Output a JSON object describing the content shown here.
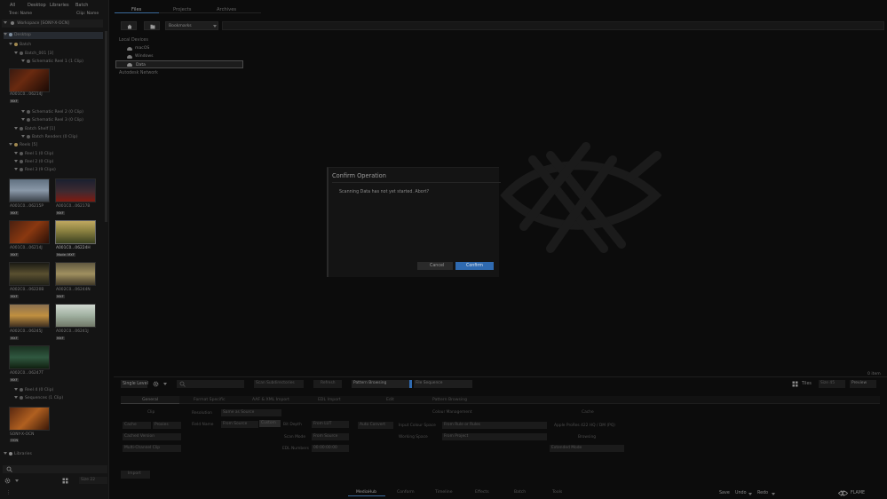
{
  "left_tabs": [
    "All",
    "Desktop",
    "Libraries",
    "Batch"
  ],
  "left_header": {
    "col1": "Tree: Name",
    "col2": "Clip: Name"
  },
  "workspace_label": "Workspace [SONY-X-OCN]",
  "tree": {
    "desktop": "Desktop",
    "batch": "Batch",
    "batch_001": "Batch_001 [3]",
    "schematic1": "Schematic Reel 1 (1 Clip)",
    "schematic2": "Schematic Reel 2 (0 Clip)",
    "schematic3": "Schematic Reel 3 (0 Clip)",
    "batch_shelf": "Batch Shelf [1]",
    "batch_renders": "Batch Renders (0 Clip)",
    "reels": "Reels [5]",
    "reel1": "Reel 1 (0 Clip)",
    "reel2": "Reel 2 (0 Clip)",
    "reel3": "Reel 3 (9 Clips)",
    "reel4": "Reel 4 (0 Clip)",
    "sequences": "Sequences (1 Clip)",
    "libraries": "Libraries"
  },
  "clips": [
    {
      "label": "A001C0...06214J",
      "badge": "MXF"
    },
    {
      "label": "A001C0...06215P",
      "badge": "MXF"
    },
    {
      "label": "A001C0...06217B",
      "badge": "MXF"
    },
    {
      "label": "A001C0...06214J",
      "badge": "MXF"
    },
    {
      "label": "A001C0...06224H",
      "badge": "Mode: MXF"
    },
    {
      "label": "A002C0...06220B",
      "badge": "MXF"
    },
    {
      "label": "A002C0...06244N",
      "badge": "MXF"
    },
    {
      "label": "A002C0...06245J",
      "badge": "MXF"
    },
    {
      "label": "A002C0...06241J",
      "badge": "MXF"
    },
    {
      "label": "A002C0...06247T",
      "badge": "MXF"
    }
  ],
  "sequence_clip": {
    "label": "SONY-X-OCN",
    "badge": "OCN"
  },
  "left_bottom": {
    "size": "Size 22"
  },
  "main_tabs": [
    "Files",
    "Projects",
    "Archives"
  ],
  "toolbar": {
    "bookmarks": "Bookmarks"
  },
  "sidebar_devices": {
    "header": "Local Devices",
    "items": [
      "macOS",
      "Windows",
      "Data"
    ],
    "network": "Autodesk Network"
  },
  "dialog": {
    "title": "Confirm Operation",
    "message": "Scanning Data has not yet started. Abort?",
    "cancel": "Cancel",
    "confirm": "Confirm"
  },
  "item_count": "0 item",
  "filter_bar": {
    "single_level": "Single Level",
    "scan_subdirectories": "Scan Subdirectories",
    "refresh": "Refresh",
    "pattern_browsing": "Pattern Browsing",
    "file_sequence": "File Sequence",
    "tiles": "Tiles",
    "size": "Size 45",
    "preview": "Preview"
  },
  "settings_tabs": [
    "General",
    "Format Specific",
    "AAF & XML Import",
    "EDL Import",
    "Edit",
    "Pattern Browsing"
  ],
  "settings": {
    "clip_header": "Clip",
    "cache": "Cache",
    "proxies": "Proxies",
    "cached_version": "Cached Version",
    "multi_channel": "Multi-Channel Clip",
    "resolution_label": "Resolution",
    "resolution_value": "Same as Source",
    "frame_rate_label": "Field Name",
    "frame_rate_value": "From Source",
    "custom_btn": "Custom",
    "bit_depth_label": "Bit Depth",
    "bit_depth_value": "From LUT",
    "scan_mode_label": "Scan Mode",
    "scan_mode_value": "From Source",
    "tc_label": "EDL Numbers",
    "tc_value": "00:00:00:00",
    "color_header": "Colour Management",
    "auto_convert": "Auto Convert",
    "input_colour_label": "Input Colour Space",
    "input_colour_value": "From Rule or Rules",
    "working_space_label": "Working Space",
    "working_space_value": "From Project",
    "cache_header": "Cache",
    "cache_format": "Apple ProRes 422 HQ / DM (PQ)",
    "browsing_header": "Browsing",
    "browse_mode": "Extended Mode",
    "import": "Import"
  },
  "bottom_tabs": [
    "MediaHub",
    "Conform",
    "Timeline",
    "Effects",
    "Batch",
    "Tools"
  ],
  "bottom_right": {
    "save": "Save",
    "undo": "Undo",
    "redo": "Redo",
    "brand": "FLAME"
  }
}
